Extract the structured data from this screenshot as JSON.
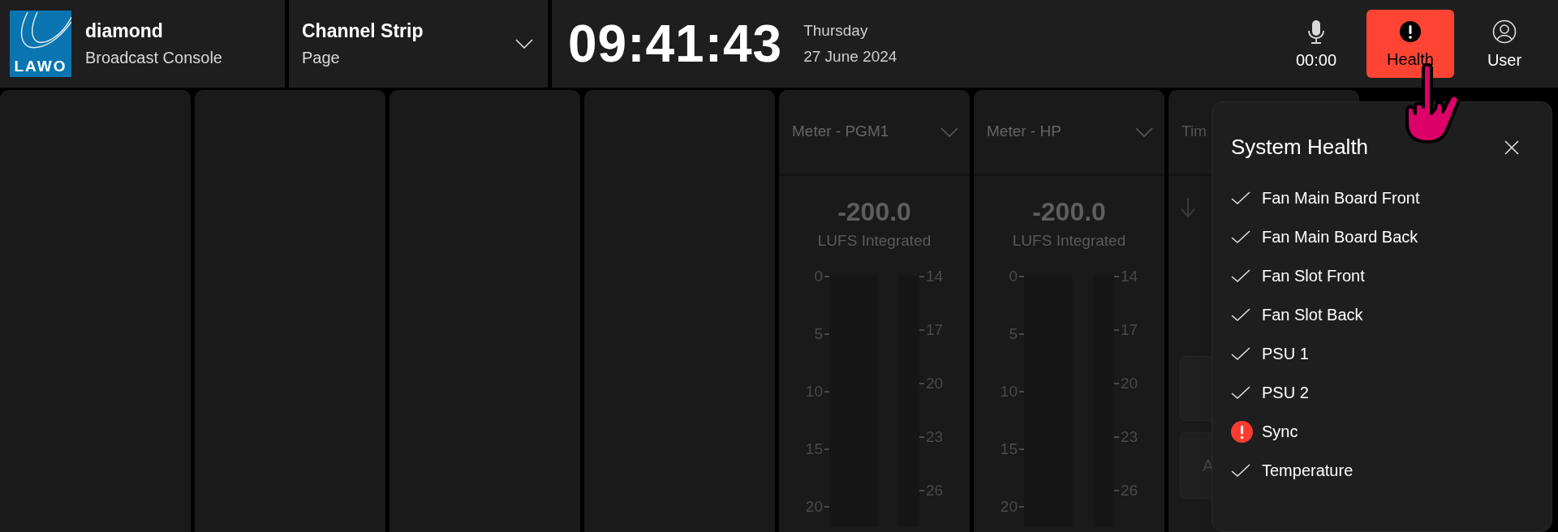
{
  "header": {
    "brand": {
      "logo_text": "LAWO",
      "name": "diamond",
      "subtitle": "Broadcast Console"
    },
    "page_selector": {
      "title": "Channel Strip",
      "subtitle": "Page"
    },
    "clock": {
      "time": "09:41:43",
      "day": "Thursday",
      "date": "27 June 2024"
    },
    "actions": [
      {
        "kind": "mic",
        "label": "00:00",
        "selected": false
      },
      {
        "kind": "health",
        "label": "Health",
        "selected": true
      },
      {
        "kind": "user",
        "label": "User",
        "selected": false
      }
    ]
  },
  "panels": [
    {
      "kind": "empty"
    },
    {
      "kind": "empty"
    },
    {
      "kind": "empty"
    },
    {
      "kind": "empty"
    },
    {
      "kind": "meter",
      "title": "Meter - PGM1",
      "value": "-200.0",
      "unit": "LUFS Integrated",
      "left_scale": [
        "0",
        "5",
        "10",
        "15",
        "20"
      ],
      "right_scale": [
        "14",
        "17",
        "20",
        "23",
        "26"
      ]
    },
    {
      "kind": "meter",
      "title": "Meter - HP",
      "value": "-200.0",
      "unit": "LUFS Integrated",
      "left_scale": [
        "0",
        "5",
        "10",
        "15",
        "20"
      ],
      "right_scale": [
        "14",
        "17",
        "20",
        "23",
        "26"
      ]
    },
    {
      "kind": "partial",
      "title": "Tim",
      "button_label": "A"
    }
  ],
  "health_popover": {
    "title": "System Health",
    "items": [
      {
        "label": "Fan Main Board Front",
        "alert": false
      },
      {
        "label": "Fan Main Board Back",
        "alert": false
      },
      {
        "label": "Fan Slot Front",
        "alert": false
      },
      {
        "label": "Fan Slot Back",
        "alert": false
      },
      {
        "label": "PSU 1",
        "alert": false
      },
      {
        "label": "PSU 2",
        "alert": false
      },
      {
        "label": "Sync",
        "alert": true
      },
      {
        "label": "Temperature",
        "alert": false
      }
    ]
  }
}
